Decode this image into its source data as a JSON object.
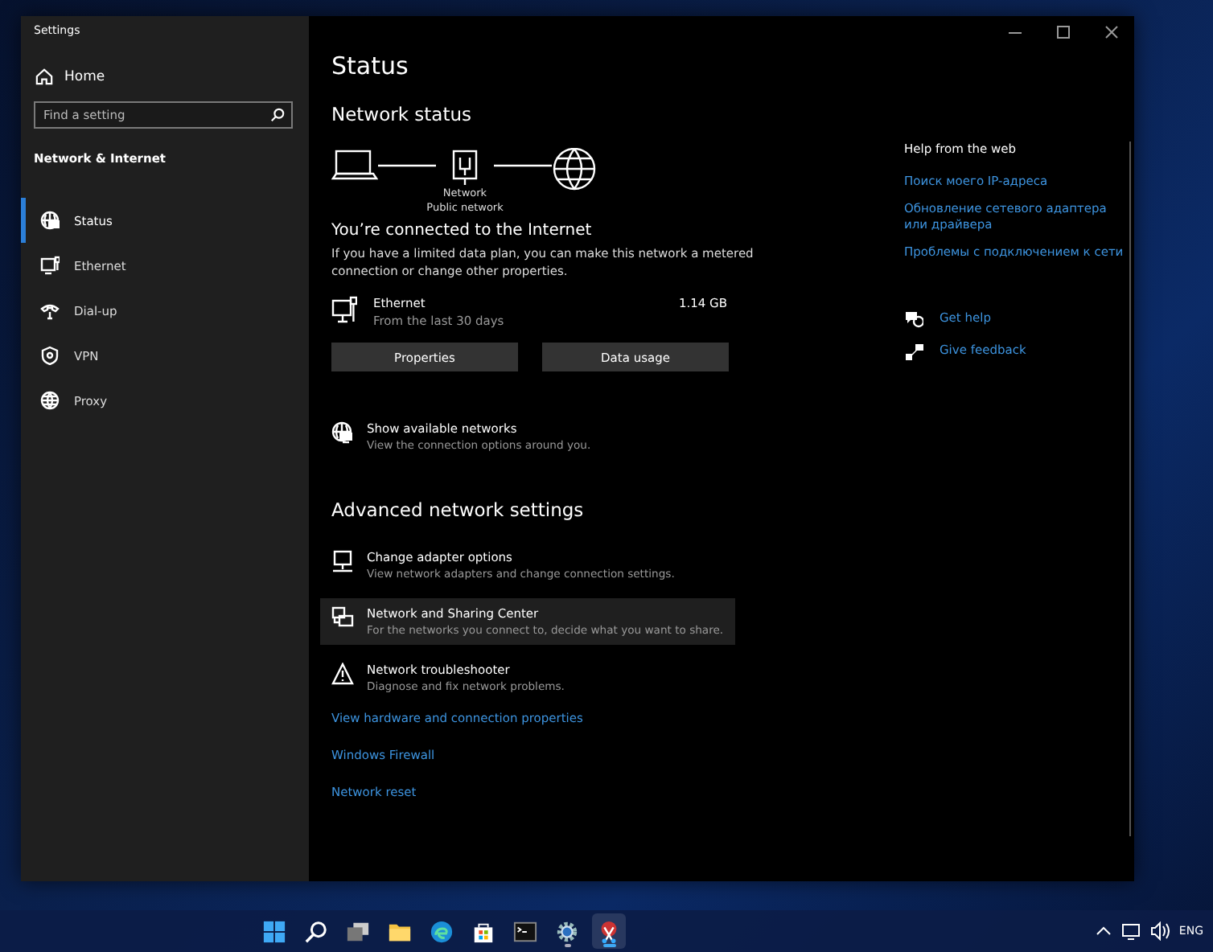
{
  "window": {
    "title": "Settings"
  },
  "sidebar": {
    "home": "Home",
    "search": {
      "placeholder": "Find a setting"
    },
    "section": "Network & Internet",
    "items": [
      {
        "label": "Status",
        "selected": true
      },
      {
        "label": "Ethernet",
        "selected": false
      },
      {
        "label": "Dial-up",
        "selected": false
      },
      {
        "label": "VPN",
        "selected": false
      },
      {
        "label": "Proxy",
        "selected": false
      }
    ]
  },
  "main": {
    "title": "Status",
    "network_status": "Network status",
    "diagram_labels": [
      "Network",
      "Public network"
    ],
    "connected_heading": "You’re connected to the Internet",
    "connected_text": "If you have a limited data plan, you can make this network a metered connection or change other properties.",
    "connection": {
      "name": "Ethernet",
      "detail": "From the last 30 days",
      "usage": "1.14 GB"
    },
    "buttons": [
      "Properties",
      "Data usage"
    ],
    "show_networks": {
      "title": "Show available networks",
      "subtitle": "View the connection options around you."
    },
    "advanced_heading": "Advanced network settings",
    "advanced_items": [
      {
        "title": "Change adapter options",
        "subtitle": "View network adapters and change connection settings.",
        "highlighted": false
      },
      {
        "title": "Network and Sharing Center",
        "subtitle": "For the networks you connect to, decide what you want to share.",
        "highlighted": true
      },
      {
        "title": "Network troubleshooter",
        "subtitle": "Diagnose and fix network problems.",
        "highlighted": false
      }
    ],
    "links": [
      "View hardware and connection properties",
      "Windows Firewall",
      "Network reset"
    ]
  },
  "help": {
    "heading": "Help from the web",
    "links": [
      "Поиск моего IP-адреса",
      "Обновление сетевого адаптера или драйвера",
      "Проблемы с подключением к сети"
    ],
    "actions": [
      "Get help",
      "Give feedback"
    ]
  },
  "taskbar": {
    "apps": [
      {
        "running": false,
        "active": false
      },
      {
        "running": false,
        "active": false
      },
      {
        "running": false,
        "active": false
      },
      {
        "running": false,
        "active": false
      },
      {
        "running": false,
        "active": false
      },
      {
        "running": false,
        "active": false
      },
      {
        "running": false,
        "active": false
      },
      {
        "running": true,
        "active": false
      },
      {
        "running": true,
        "active": true
      }
    ],
    "language": "ENG"
  }
}
